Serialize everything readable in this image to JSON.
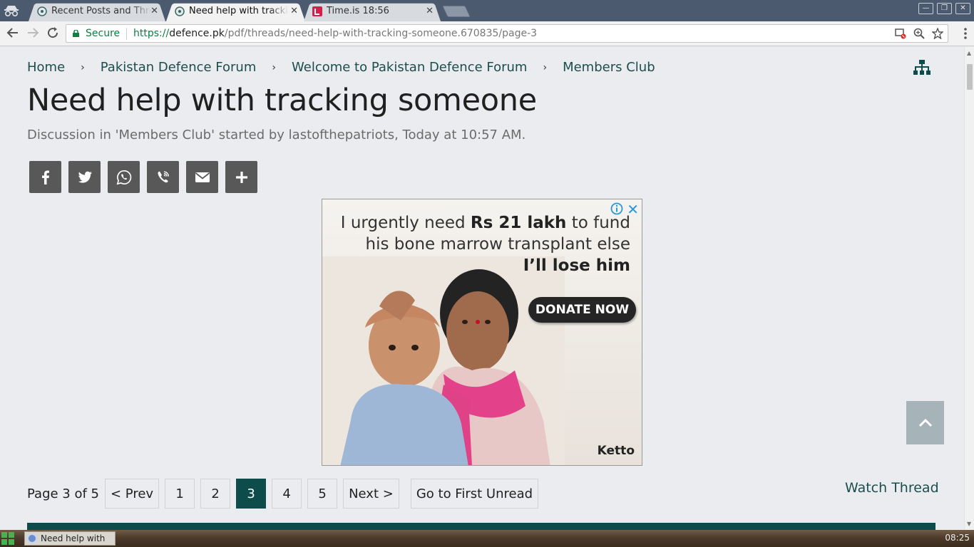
{
  "browser": {
    "tabs": [
      {
        "title": "Recent Posts and Threads",
        "active": false,
        "favicon": "pdf-favicon"
      },
      {
        "title": "Need help with tracking",
        "active": true,
        "favicon": "pdf-favicon"
      },
      {
        "title": "Time.is 18:56",
        "active": false,
        "favicon": "timeis-favicon"
      }
    ],
    "secure_label": "Secure",
    "url_scheme": "https://",
    "url_host": "defence.pk",
    "url_path": "/pdf/threads/need-help-with-tracking-someone.670835/page-3"
  },
  "breadcrumb": [
    "Home",
    "Pakistan Defence Forum",
    "Welcome to Pakistan Defence Forum",
    "Members Club"
  ],
  "breadcrumb_separator": "›",
  "thread": {
    "title": "Need help with tracking someone",
    "meta": "Discussion in 'Members Club' started by lastofthepatriots, Today at 10:57 AM."
  },
  "share_buttons": [
    "facebook-icon",
    "twitter-icon",
    "whatsapp-icon",
    "viber-icon",
    "email-icon",
    "plus-icon"
  ],
  "ad": {
    "line1_pre": "I urgently need ",
    "line1_bold": "Rs 21 lakh",
    "line1_post": " to fund",
    "line2": "his bone marrow transplant else",
    "line3_bold": "I’ll lose him",
    "donate_label": "DONATE NOW",
    "brand": "Ketto",
    "close": "✕"
  },
  "pagination": {
    "label": "Page 3 of 5",
    "prev": "< Prev",
    "pages": [
      "1",
      "2",
      "3",
      "4",
      "5"
    ],
    "current": "3",
    "next": "Next >",
    "first_unread": "Go to First Unread"
  },
  "watch_thread": "Watch Thread",
  "taskbar": {
    "item": "Need help with",
    "clock": "08:25"
  },
  "colors": {
    "accent": "#0e4b4b",
    "link": "#1b4e4b",
    "share_bg": "#585858",
    "page_bg": "#ebecef"
  }
}
